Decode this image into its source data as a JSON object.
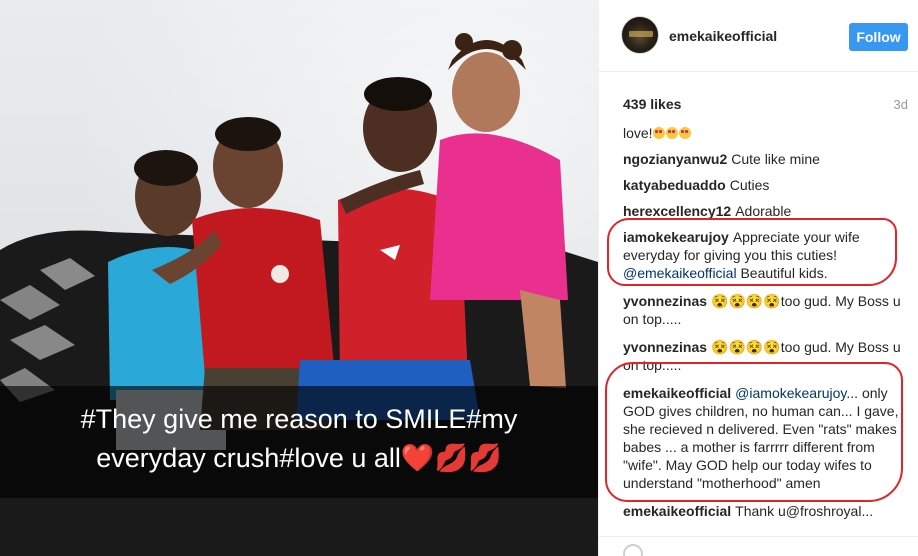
{
  "post": {
    "caption_overlay": "#They give me reason to SMILE#my\neveryday crush#love u all❤️💋💋"
  },
  "header": {
    "username": "emekaikeofficial",
    "follow_label": "Follow"
  },
  "stats": {
    "likes": "439 likes",
    "time": "3d"
  },
  "comments": [
    {
      "user": "",
      "text": "love!",
      "emoji_count": 3
    },
    {
      "user": "ngozianyanwu2",
      "text": "Cute like mine"
    },
    {
      "user": "katyabeduaddo",
      "text": "Cuties"
    },
    {
      "user": "herexcellency12",
      "text": "Adorable"
    },
    {
      "user": "iamokekearujoy",
      "text": "Appreciate your wife everyday for giving you this cuties!",
      "mention": "@emekaikeofficial",
      "text_after": "Beautiful kids."
    },
    {
      "user": "yvonnezinas",
      "emoji": "😵😵😵😵",
      "text": "too gud. My Boss u on top....."
    },
    {
      "user": "yvonnezinas",
      "emoji": "😵😵😵😵",
      "text": "too gud. My Boss u on top....."
    },
    {
      "user": "emekaikeofficial",
      "mention": "@iamokekearujoy",
      "text": "... only GOD gives children, no human can... I gave, she recieved n delivered. Even \"rats\" makes babes ... a mother is farrrrr different from \"wife\". May GOD help our today wifes to understand \"motherhood\" amen"
    },
    {
      "user": "emekaikeofficial",
      "text": "Thank u@froshroyal..."
    }
  ],
  "colors": {
    "follow_bg": "#3897f0",
    "annotation_red": "#e0242a",
    "mention_blue": "#003569"
  }
}
